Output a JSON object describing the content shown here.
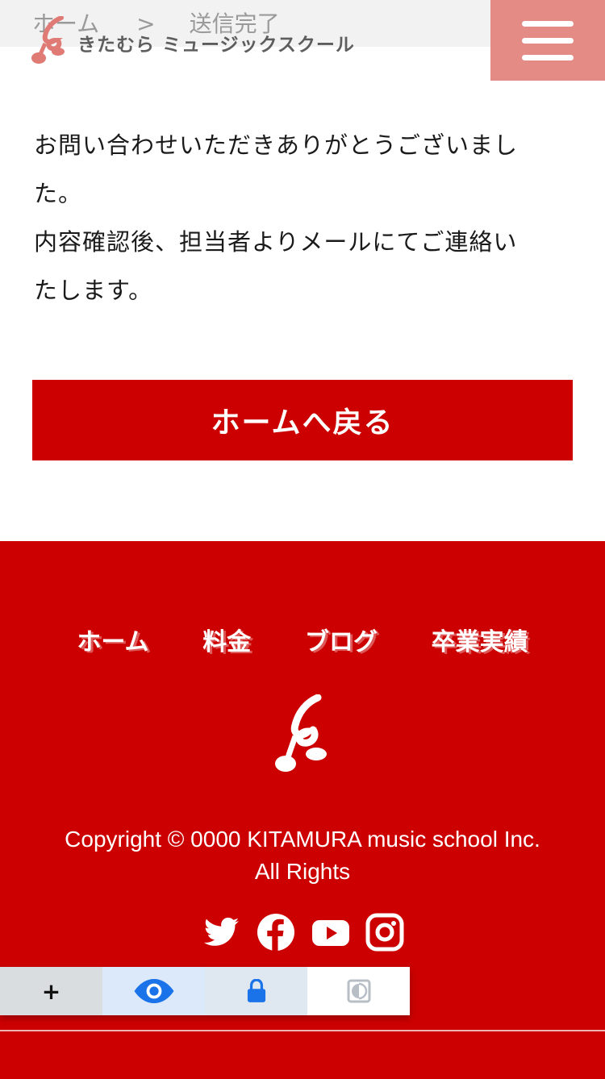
{
  "breadcrumb": {
    "home": "ホーム",
    "separator": ">",
    "current": "送信完了"
  },
  "brand": {
    "name": "きたむら ミュージックスクール"
  },
  "menu": {
    "icon": "hamburger-menu-icon"
  },
  "message": {
    "line1": "お問い合わせいただきありがとうございまし",
    "line2": "た。",
    "line3": "内容確認後、担当者よりメールにてご連絡い",
    "line4": "たします。"
  },
  "home_button": {
    "label": "ホームへ戻る"
  },
  "footer": {
    "nav": [
      "ホーム",
      "料金",
      "ブログ",
      "卒業実績"
    ],
    "copyright_line1": "Copyright © 0000 KITAMURA music school Inc.",
    "copyright_line2": "All Rights",
    "social_icons": [
      "twitter-icon",
      "facebook-icon",
      "youtube-icon",
      "instagram-icon"
    ]
  },
  "accessibility_toolbar": {
    "zoom_label": "+",
    "icons": [
      "plus-icon",
      "eye-icon",
      "lock-icon",
      "contrast-icon"
    ]
  },
  "colors": {
    "brand_red": "#cc0000",
    "menu_pink": "#e58b86",
    "breadcrumb_bg": "#f2f2f2"
  }
}
